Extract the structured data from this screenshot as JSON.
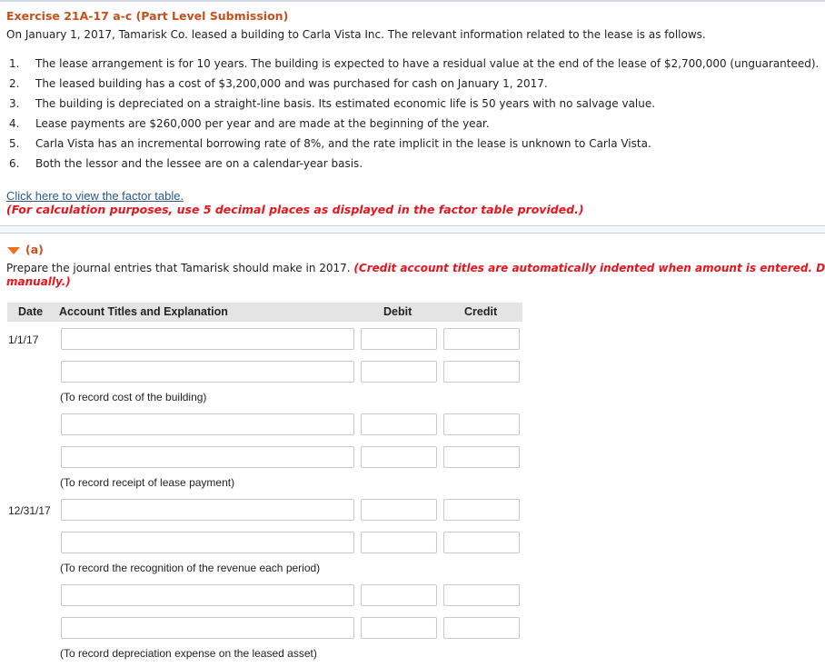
{
  "exercise": {
    "title": "Exercise 21A-17 a-c (Part Level Submission)",
    "intro": "On January 1, 2017, Tamarisk Co. leased a building to Carla Vista Inc. The relevant information related to the lease is as follows.",
    "facts": [
      {
        "num": "1.",
        "text": "The lease arrangement is for 10 years. The building is expected to have a residual value at the end of the lease of $2,700,000 (unguaranteed)."
      },
      {
        "num": "2.",
        "text": "The leased building has a cost of $3,200,000 and was purchased for cash on January 1, 2017."
      },
      {
        "num": "3.",
        "text": "The building is depreciated on a straight-line basis. Its estimated economic life is 50 years with no salvage value."
      },
      {
        "num": "4.",
        "text": "Lease payments are $260,000 per year and are made at the beginning of the year."
      },
      {
        "num": "5.",
        "text": "Carla Vista has an incremental borrowing rate of 8%, and the rate implicit in the lease is unknown to Carla Vista."
      },
      {
        "num": "6.",
        "text": "Both the lessor and the lessee are on a calendar-year basis."
      }
    ],
    "factor_link": "Click here to view the factor table.",
    "calc_note": "(For calculation purposes, use 5 decimal places as displayed in the factor table provided.)"
  },
  "part_a": {
    "label": "(a)",
    "prompt": "Prepare the journal entries that Tamarisk should make in 2017.",
    "prompt_note": "(Credit account titles are automatically indented when amount is entered. Do not indent manually.)",
    "table": {
      "headers": {
        "date": "Date",
        "account": "Account Titles and Explanation",
        "debit": "Debit",
        "credit": "Credit"
      },
      "entries": [
        {
          "date": "1/1/17",
          "rows": [
            {
              "account": "",
              "debit": "",
              "credit": ""
            },
            {
              "account": "",
              "debit": "",
              "credit": ""
            }
          ],
          "note": "(To record cost of the building)"
        },
        {
          "date": "",
          "rows": [
            {
              "account": "",
              "debit": "",
              "credit": ""
            },
            {
              "account": "",
              "debit": "",
              "credit": ""
            }
          ],
          "note": "(To record receipt of lease payment)"
        },
        {
          "date": "12/31/17",
          "rows": [
            {
              "account": "",
              "debit": "",
              "credit": ""
            },
            {
              "account": "",
              "debit": "",
              "credit": ""
            }
          ],
          "note": "(To record the recognition of the revenue each period)"
        },
        {
          "date": "",
          "rows": [
            {
              "account": "",
              "debit": "",
              "credit": ""
            },
            {
              "account": "",
              "debit": "",
              "credit": ""
            }
          ],
          "note": "(To record depreciation expense on the leased asset)"
        }
      ]
    }
  },
  "colors": {
    "title": "#c4501b",
    "note_red": "#e8141b",
    "link": "#2a5a8a",
    "triangle": "#f26c1f",
    "table_header_bg": "#e4e4e4"
  }
}
